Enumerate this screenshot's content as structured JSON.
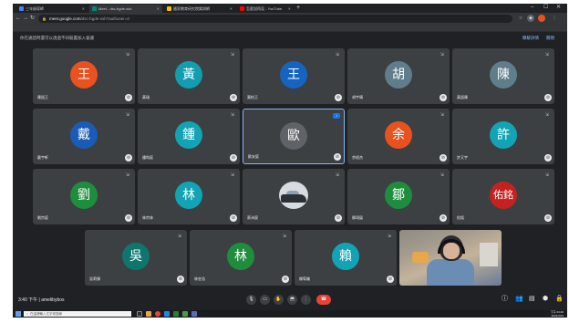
{
  "browser": {
    "tabs": [
      {
        "title": "三年級導師",
        "color": "#4285f4"
      },
      {
        "title": "Meet - dsc-bgde-ssh",
        "color": "#00897b",
        "active": true
      },
      {
        "title": "國家教育研究院樂詞網",
        "color": "#fbbc04"
      },
      {
        "title": "怎麼說再見 - YouTube",
        "color": "#ff0000"
      }
    ],
    "new_tab": "+",
    "url_host": "meet.google.com",
    "url_path": "/dsc-bgde-ssh?authuser=0"
  },
  "banner": {
    "message": "你在通話時還可以透過不同裝置加入會議",
    "action1": "瞭解詳情",
    "action2": "關閉"
  },
  "participants": [
    {
      "char": "王",
      "color": "#e8521f",
      "name": "陳語王"
    },
    {
      "char": "黃",
      "color": "#129eaf",
      "name": "黃瑞"
    },
    {
      "char": "王",
      "color": "#1565c0",
      "name": "葉柏王"
    },
    {
      "char": "胡",
      "color": "#607d8b",
      "name": "胡宇晴"
    },
    {
      "char": "陳",
      "color": "#607d8b",
      "name": "黃語陳"
    },
    {
      "char": "戴",
      "color": "#1a5bb8",
      "name": "戴宇軒"
    },
    {
      "char": "鍾",
      "color": "#12a4b5",
      "name": "鍾昀庭"
    },
    {
      "char": "歐",
      "color": "#5f6368",
      "name": "歐安庭"
    },
    {
      "char": "余",
      "color": "#e8521f",
      "name": "余紹杰"
    },
    {
      "char": "許",
      "color": "#12a4b5",
      "name": "許又宇"
    },
    {
      "char": "劉",
      "color": "#1e8e3e",
      "name": "劉宗庭"
    },
    {
      "char": "林",
      "color": "#12a4b5",
      "name": "林宗林"
    },
    {
      "char": "",
      "color": "#d7dbe0",
      "name": "蔡沛宸"
    },
    {
      "char": "鄒",
      "color": "#1e8e3e",
      "name": "鄒翊展"
    },
    {
      "char": "佑銘",
      "color": "#c5221f",
      "name": "佑銘"
    },
    {
      "char": "吳",
      "color": "#0f766e",
      "name": "吳莉臻"
    },
    {
      "char": "林",
      "color": "#1e8e3e",
      "name": "林芸浩"
    },
    {
      "char": "賴",
      "color": "#12a4b5",
      "name": "賴宥儀"
    }
  ],
  "controls": {
    "time": "3:40 下午",
    "separator": "|",
    "meeting_code": "amelibybos"
  },
  "taskbar": {
    "search_placeholder": "在這裡輸入文字來搜尋",
    "clock_time": "下午 03:40",
    "clock_date": "2021/4/14"
  }
}
